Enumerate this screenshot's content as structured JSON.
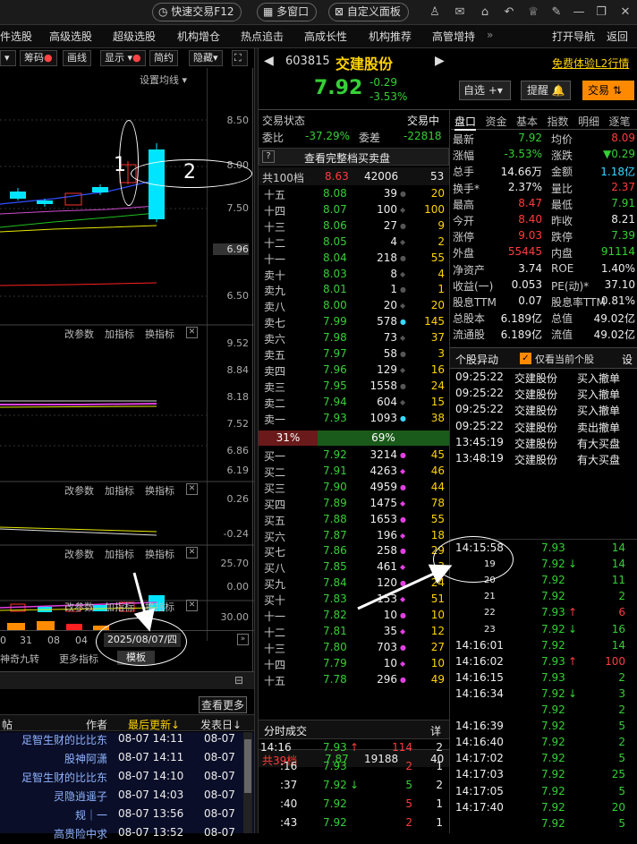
{
  "topbar": {
    "fast_trade": "快速交易F12",
    "multi_window": "多窗口",
    "custom_panel": "自定义面板"
  },
  "nav": {
    "items": [
      "件选股",
      "高级选股",
      "超级选股",
      "机构增仓",
      "热点追击",
      "高成长性",
      "机构推荐",
      "高管增持"
    ],
    "more": "»",
    "open_nav": "打开导航",
    "back": "返回"
  },
  "chart_toolbar": {
    "chips": "筹码",
    "draw": "画线",
    "display": "显示",
    "simple": "简约",
    "hide": "隐藏"
  },
  "kline": {
    "ma_setting": "设置均线",
    "yticks": [
      "8.50",
      "8.00",
      "7.50",
      "6.96",
      "6.50"
    ]
  },
  "panel1": {
    "modify": "改参数",
    "add": "加指标",
    "switch": "换指标",
    "yticks": [
      "9.52",
      "8.84",
      "8.18",
      "7.52",
      "6.86",
      "6.19"
    ]
  },
  "panel2": {
    "modify": "改参数",
    "add": "加指标",
    "switch": "换指标",
    "yticks": [
      "0.26",
      "-0.24"
    ]
  },
  "panel3": {
    "modify": "改参数",
    "add": "加指标",
    "switch": "换指标",
    "yticks": [
      "25.70",
      "0.00"
    ]
  },
  "panel4": {
    "modify": "改参数",
    "add": "加指标",
    "switch": "换指标",
    "yticks": [
      "30.00"
    ]
  },
  "date_axis": {
    "labels": [
      "0",
      "31",
      "08",
      "04"
    ],
    "selected_date": "2025/08/07/四",
    "template": "模板"
  },
  "left_bottom_tabs": {
    "t1": "神奇九转",
    "t2": "更多指标"
  },
  "posts": {
    "view_more": "查看更多",
    "col_title": "帖",
    "col_author": "作者",
    "col_updated": "最后更新↓",
    "col_post": "发表日↓",
    "rows": [
      {
        "author": "足智生财的比比东",
        "updated": "08-07 14:11",
        "posted": "08-07"
      },
      {
        "author": "股神阿潇",
        "updated": "08-07 14:11",
        "posted": "08-07"
      },
      {
        "author": "足智生财的比比东",
        "updated": "08-07 14:10",
        "posted": "08-07"
      },
      {
        "author": "灵隐逍遥子",
        "updated": "08-07 14:03",
        "posted": "08-07"
      },
      {
        "author": "规｜一",
        "updated": "08-07 13:56",
        "posted": "08-07"
      },
      {
        "author": "高贵险中求",
        "updated": "08-07 13:52",
        "posted": "08-07"
      }
    ]
  },
  "stock": {
    "code": "603815",
    "name": "交建股份",
    "price": "7.92",
    "change": "-0.29",
    "pct": "-3.53%",
    "free_l2": "免费体验L2行情",
    "watchlist": "自选",
    "remind": "提醒",
    "trade": "交易"
  },
  "orderbook": {
    "status_label": "交易状态",
    "status_value": "交易中",
    "ratio_label": "委比",
    "ratio_value": "-37.29%",
    "diff_label": "委差",
    "diff_value": "-22818",
    "full_btn": "查看完整档买卖盘",
    "sell_total": {
      "label": "共100档",
      "price": "8.63",
      "vol": "42006",
      "count": "53"
    },
    "asks": [
      {
        "l": "十五",
        "p": "8.08",
        "v": "39",
        "c": "20"
      },
      {
        "l": "十四",
        "p": "8.07",
        "v": "100",
        "c": "100"
      },
      {
        "l": "十三",
        "p": "8.06",
        "v": "27",
        "c": "9"
      },
      {
        "l": "十二",
        "p": "8.05",
        "v": "4",
        "c": "2"
      },
      {
        "l": "十一",
        "p": "8.04",
        "v": "218",
        "c": "55"
      },
      {
        "l": "卖十",
        "p": "8.03",
        "v": "8",
        "c": "4"
      },
      {
        "l": "卖九",
        "p": "8.01",
        "v": "1",
        "c": "1"
      },
      {
        "l": "卖八",
        "p": "8.00",
        "v": "20",
        "c": "20"
      },
      {
        "l": "卖七",
        "p": "7.99",
        "v": "578",
        "c": "145"
      },
      {
        "l": "卖六",
        "p": "7.98",
        "v": "73",
        "c": "37"
      },
      {
        "l": "卖五",
        "p": "7.97",
        "v": "58",
        "c": "3"
      },
      {
        "l": "卖四",
        "p": "7.96",
        "v": "129",
        "c": "16"
      },
      {
        "l": "卖三",
        "p": "7.95",
        "v": "1558",
        "c": "24"
      },
      {
        "l": "卖二",
        "p": "7.94",
        "v": "604",
        "c": "15"
      },
      {
        "l": "卖一",
        "p": "7.93",
        "v": "1093",
        "c": "38"
      }
    ],
    "split": {
      "left": "31%",
      "right": "69%"
    },
    "bids": [
      {
        "l": "买一",
        "p": "7.92",
        "v": "3214",
        "c": "45"
      },
      {
        "l": "买二",
        "p": "7.91",
        "v": "4263",
        "c": "46"
      },
      {
        "l": "买三",
        "p": "7.90",
        "v": "4959",
        "c": "44"
      },
      {
        "l": "买四",
        "p": "7.89",
        "v": "1475",
        "c": "78"
      },
      {
        "l": "买五",
        "p": "7.88",
        "v": "1653",
        "c": "55"
      },
      {
        "l": "买六",
        "p": "7.87",
        "v": "196",
        "c": "18"
      },
      {
        "l": "买七",
        "p": "7.86",
        "v": "258",
        "c": "29"
      },
      {
        "l": "买八",
        "p": "7.85",
        "v": "461",
        "c": "3"
      },
      {
        "l": "买九",
        "p": "7.84",
        "v": "120",
        "c": "24"
      },
      {
        "l": "买十",
        "p": "7.83",
        "v": "153",
        "c": "51"
      },
      {
        "l": "十一",
        "p": "7.82",
        "v": "10",
        "c": "10"
      },
      {
        "l": "十二",
        "p": "7.81",
        "v": "35",
        "c": "12"
      },
      {
        "l": "十三",
        "p": "7.80",
        "v": "703",
        "c": "27"
      },
      {
        "l": "十四",
        "p": "7.79",
        "v": "10",
        "c": "10"
      },
      {
        "l": "十五",
        "p": "7.78",
        "v": "296",
        "c": "49"
      }
    ],
    "buy_total": {
      "label": "共39档",
      "price": "7.87",
      "vol": "19188",
      "count": "40"
    }
  },
  "trades_left": {
    "title": "分时成交",
    "detail": "详",
    "rows": [
      {
        "t": "14:16",
        "p": "7.93",
        "arrow": "↑",
        "v": "114",
        "n": "2"
      },
      {
        "t": ":16",
        "p": "7.93",
        "arrow": "",
        "v": "2",
        "n": "1"
      },
      {
        "t": ":37",
        "p": "7.92",
        "arrow": "↓",
        "v": "5",
        "n": "2"
      },
      {
        "t": ":40",
        "p": "7.92",
        "arrow": "",
        "v": "5",
        "n": "1"
      },
      {
        "t": ":43",
        "p": "7.92",
        "arrow": "",
        "v": "2",
        "n": "1"
      }
    ]
  },
  "quote_tabs": [
    "盘口",
    "资金",
    "基本",
    "指数",
    "明细",
    "逐笔"
  ],
  "quote": [
    {
      "l1": "最新",
      "v1": "7.92",
      "l2": "均价",
      "v2": "8.09"
    },
    {
      "l1": "涨幅",
      "v1": "-3.53%",
      "l2": "涨跌",
      "v2": "▼0.29"
    },
    {
      "l1": "总手",
      "v1": "14.66万",
      "l2": "金额",
      "v2": "1.18亿"
    },
    {
      "l1": "换手*",
      "v1": "2.37%",
      "l2": "量比",
      "v2": "2.37"
    },
    {
      "l1": "最高",
      "v1": "8.47",
      "l2": "最低",
      "v2": "7.91"
    },
    {
      "l1": "今开",
      "v1": "8.40",
      "l2": "昨收",
      "v2": "8.21"
    },
    {
      "l1": "涨停",
      "v1": "9.03",
      "l2": "跌停",
      "v2": "7.39"
    },
    {
      "l1": "外盘",
      "v1": "55445",
      "l2": "内盘",
      "v2": "91114"
    },
    {
      "l1": "净资产",
      "v1": "3.74",
      "l2": "ROE",
      "v2": "1.40%"
    },
    {
      "l1": "收益(一)",
      "v1": "0.053",
      "l2": "PE(动)*",
      "v2": "37.10"
    },
    {
      "l1": "股息TTM",
      "v1": "0.07",
      "l2": "股息率TTM",
      "v2": "0.81%"
    },
    {
      "l1": "总股本",
      "v1": "6.189亿",
      "l2": "总值",
      "v2": "49.02亿"
    },
    {
      "l1": "流通股",
      "v1": "6.189亿",
      "l2": "流值",
      "v2": "49.02亿"
    }
  ],
  "anomaly": {
    "title": "个股异动",
    "checkbox": "仅看当前个股",
    "settings": "设",
    "rows": [
      {
        "t": "09:25:22",
        "n": "交建股份",
        "e": "买入撤单"
      },
      {
        "t": "09:25:22",
        "n": "交建股份",
        "e": "买入撤单"
      },
      {
        "t": "09:25:22",
        "n": "交建股份",
        "e": "买入撤单"
      },
      {
        "t": "09:25:22",
        "n": "交建股份",
        "e": "卖出撤单"
      },
      {
        "t": "13:45:19",
        "n": "交建股份",
        "e": "有大买盘"
      },
      {
        "t": "13:48:19",
        "n": "交建股份",
        "e": "有大买盘"
      }
    ]
  },
  "ticks": [
    {
      "t": "14:15:58",
      "p": "7.93",
      "a": "",
      "v": "14"
    },
    {
      "t": "19",
      "p": "7.92",
      "a": "↓",
      "v": "14"
    },
    {
      "t": "20",
      "p": "7.92",
      "a": "",
      "v": "11"
    },
    {
      "t": "21",
      "p": "7.92",
      "a": "",
      "v": "2"
    },
    {
      "t": "22",
      "p": "7.93",
      "a": "↑",
      "v": "6"
    },
    {
      "t": "23",
      "p": "7.92",
      "a": "↓",
      "v": "16"
    },
    {
      "t": "14:16:01",
      "p": "7.92",
      "a": "",
      "v": "14"
    },
    {
      "t": "14:16:02",
      "p": "7.93",
      "a": "↑",
      "v": "100"
    },
    {
      "t": "14:16:15",
      "p": "7.93",
      "a": "",
      "v": "2"
    },
    {
      "t": "14:16:34",
      "p": "7.92",
      "a": "↓",
      "v": "3"
    },
    {
      "t": "",
      "p": "7.92",
      "a": "",
      "v": "2"
    },
    {
      "t": "14:16:39",
      "p": "7.92",
      "a": "",
      "v": "5"
    },
    {
      "t": "14:16:40",
      "p": "7.92",
      "a": "",
      "v": "2"
    },
    {
      "t": "14:17:02",
      "p": "7.92",
      "a": "",
      "v": "5"
    },
    {
      "t": "14:17:03",
      "p": "7.92",
      "a": "",
      "v": "25"
    },
    {
      "t": "14:17:05",
      "p": "7.92",
      "a": "",
      "v": "5"
    },
    {
      "t": "14:17:40",
      "p": "7.92",
      "a": "",
      "v": "20"
    },
    {
      "t": "",
      "p": "7.92",
      "a": "",
      "v": "5"
    }
  ],
  "annotations": {
    "n1": "1",
    "n2": "2"
  },
  "colors": {
    "up": "#ff3c3c",
    "down": "#35d035",
    "accent": "#ffd400",
    "trade_btn": "#ff8a00",
    "cyan_candle": "#00e5ff"
  }
}
